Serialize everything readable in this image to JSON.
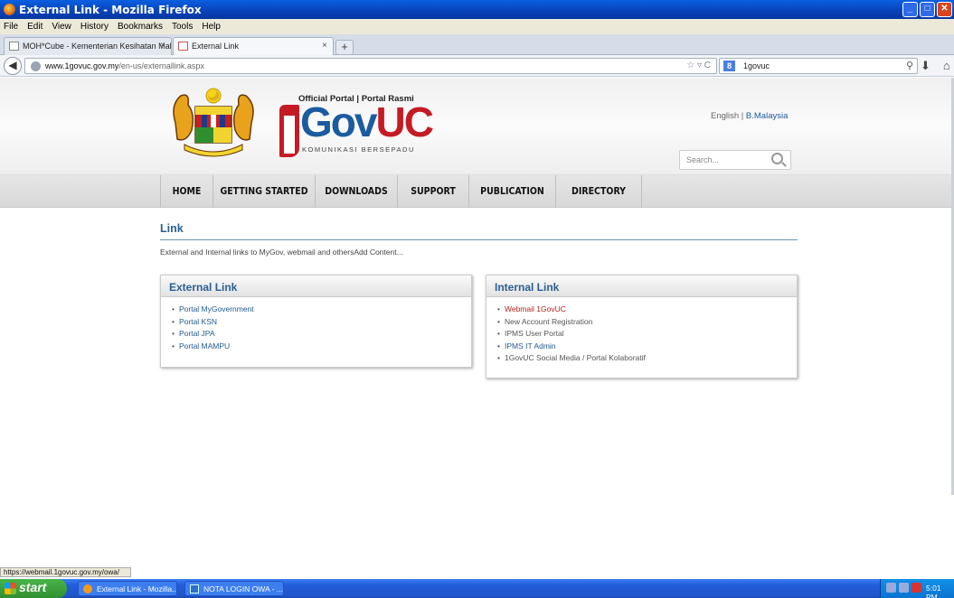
{
  "window": {
    "title": "External Link - Mozilla Firefox"
  },
  "menu": [
    "File",
    "Edit",
    "View",
    "History",
    "Bookmarks",
    "Tools",
    "Help"
  ],
  "tabs": [
    {
      "label": "MOH*Cube - Kementerian Kesihatan Mal...",
      "active": false
    },
    {
      "label": "External Link",
      "active": true
    }
  ],
  "newtab_glyph": "+",
  "url": {
    "domain": "www.1govuc.gov.my",
    "path": "/en-us/externallink.aspx"
  },
  "search_engine": {
    "value": "1govuc",
    "engine_letter": "8"
  },
  "site": {
    "tagline": "Official Portal | Portal Rasmi",
    "logo_main": "Gov",
    "logo_accent": "UC",
    "logo_sub": "KOMUNIKASI BERSEPADU",
    "lang_english": "English",
    "lang_sep": " | ",
    "lang_bm": "B.Malaysia",
    "search_placeholder": "Search...",
    "nav": [
      "HOME",
      "GETTING STARTED",
      "DOWNLOADS",
      "SUPPORT",
      "PUBLICATION",
      "DIRECTORY"
    ]
  },
  "page": {
    "title": "Link",
    "description": "External and Internal links to MyGov, webmail and othersAdd Content..."
  },
  "external_box": {
    "title": "External Link",
    "links": [
      "Portal MyGovernment",
      "Portal KSN",
      "Portal JPA",
      "Portal MAMPU"
    ]
  },
  "internal_box": {
    "title": "Internal Link",
    "links": [
      "Webmail 1GovUC",
      "New Account Registration",
      "IPMS User Portal",
      "IPMS IT Admin",
      "1GovUC Social Media / Portal Kolaboratif"
    ]
  },
  "status": "https://webmail.1govuc.gov.my/owa/",
  "taskbar": {
    "start": "start",
    "tasks": [
      "External Link - Mozilla...",
      "NOTA LOGIN OWA - ..."
    ],
    "time": "5:01 PM"
  },
  "colors": {
    "link_blue": "#1f5a8f",
    "link_red": "#b22020",
    "brand_red": "#c51b24",
    "brand_blue": "#1b5ba0"
  }
}
